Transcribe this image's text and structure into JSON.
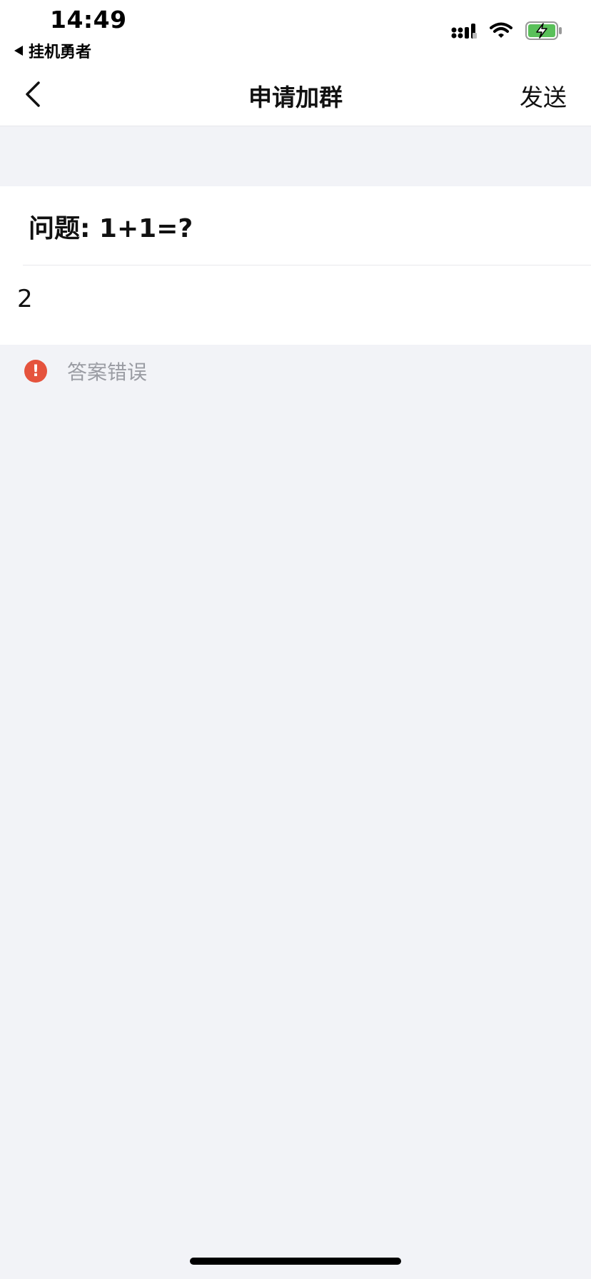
{
  "status_bar": {
    "time": "14:49",
    "back_app": "挂机勇者",
    "icons": [
      "signal-icon",
      "wifi-icon",
      "battery-charging-icon"
    ],
    "battery_color": "#5ac05a"
  },
  "nav": {
    "title": "申请加群",
    "send_label": "发送"
  },
  "form": {
    "question": "问题: 1+1=?",
    "answer_value": "2"
  },
  "error": {
    "message": "答案错误",
    "icon_color": "#e5533d"
  }
}
